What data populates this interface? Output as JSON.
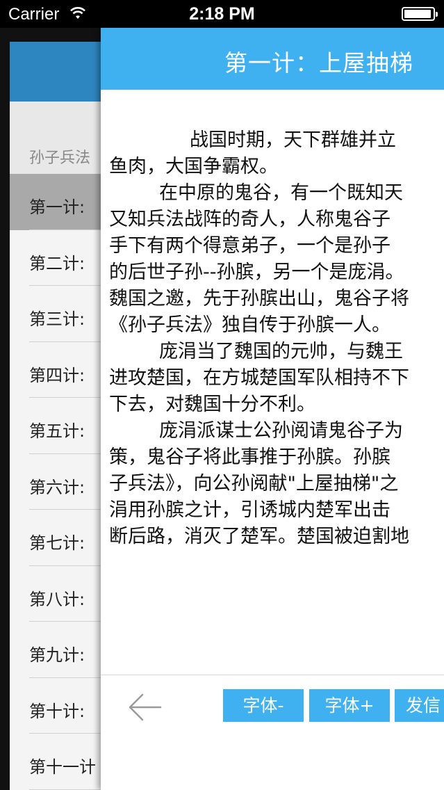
{
  "status_bar": {
    "carrier": "Carrier",
    "time": "2:18 PM",
    "battery_level": 0.95
  },
  "list": {
    "section_title": "孙子兵法",
    "items": [
      {
        "label": "第一计:"
      },
      {
        "label": "第二计:"
      },
      {
        "label": "第三计:"
      },
      {
        "label": "第四计:"
      },
      {
        "label": "第五计:"
      },
      {
        "label": "第六计:"
      },
      {
        "label": "第七计:"
      },
      {
        "label": "第八计:"
      },
      {
        "label": "第九计:"
      },
      {
        "label": "第十计:"
      },
      {
        "label": "第十一计"
      }
    ]
  },
  "reader": {
    "title": "第一计：上屋抽梯",
    "lines": [
      "战国时期，天下群雄并立",
      "鱼肉，大国争霸权。",
      "在中原的鬼谷，有一个既知天",
      "又知兵法战阵的奇人，人称鬼谷子",
      "手下有两个得意弟子，一个是孙子",
      "的后世子孙--孙膑，另一个是庞涓。",
      "魏国之邀，先于孙膑出山，鬼谷子将",
      "《孙子兵法》独自传于孙膑一人。",
      "庞涓当了魏国的元帅，与魏王",
      "进攻楚国，在方城楚国军队相持不下",
      "下去，对魏国十分不利。",
      "庞涓派谋士公孙阅请鬼谷子为",
      "策，鬼谷子将此事推于孙膑。孙膑",
      "子兵法》，向公孙阅献\"上屋抽梯\"之",
      "涓用孙膑之计，引诱城内楚军出击",
      "断后路，消灭了楚军。楚国被迫割地"
    ],
    "toolbar": {
      "font_decrease": "字体-",
      "font_increase": "字体+",
      "send": "发信"
    }
  }
}
